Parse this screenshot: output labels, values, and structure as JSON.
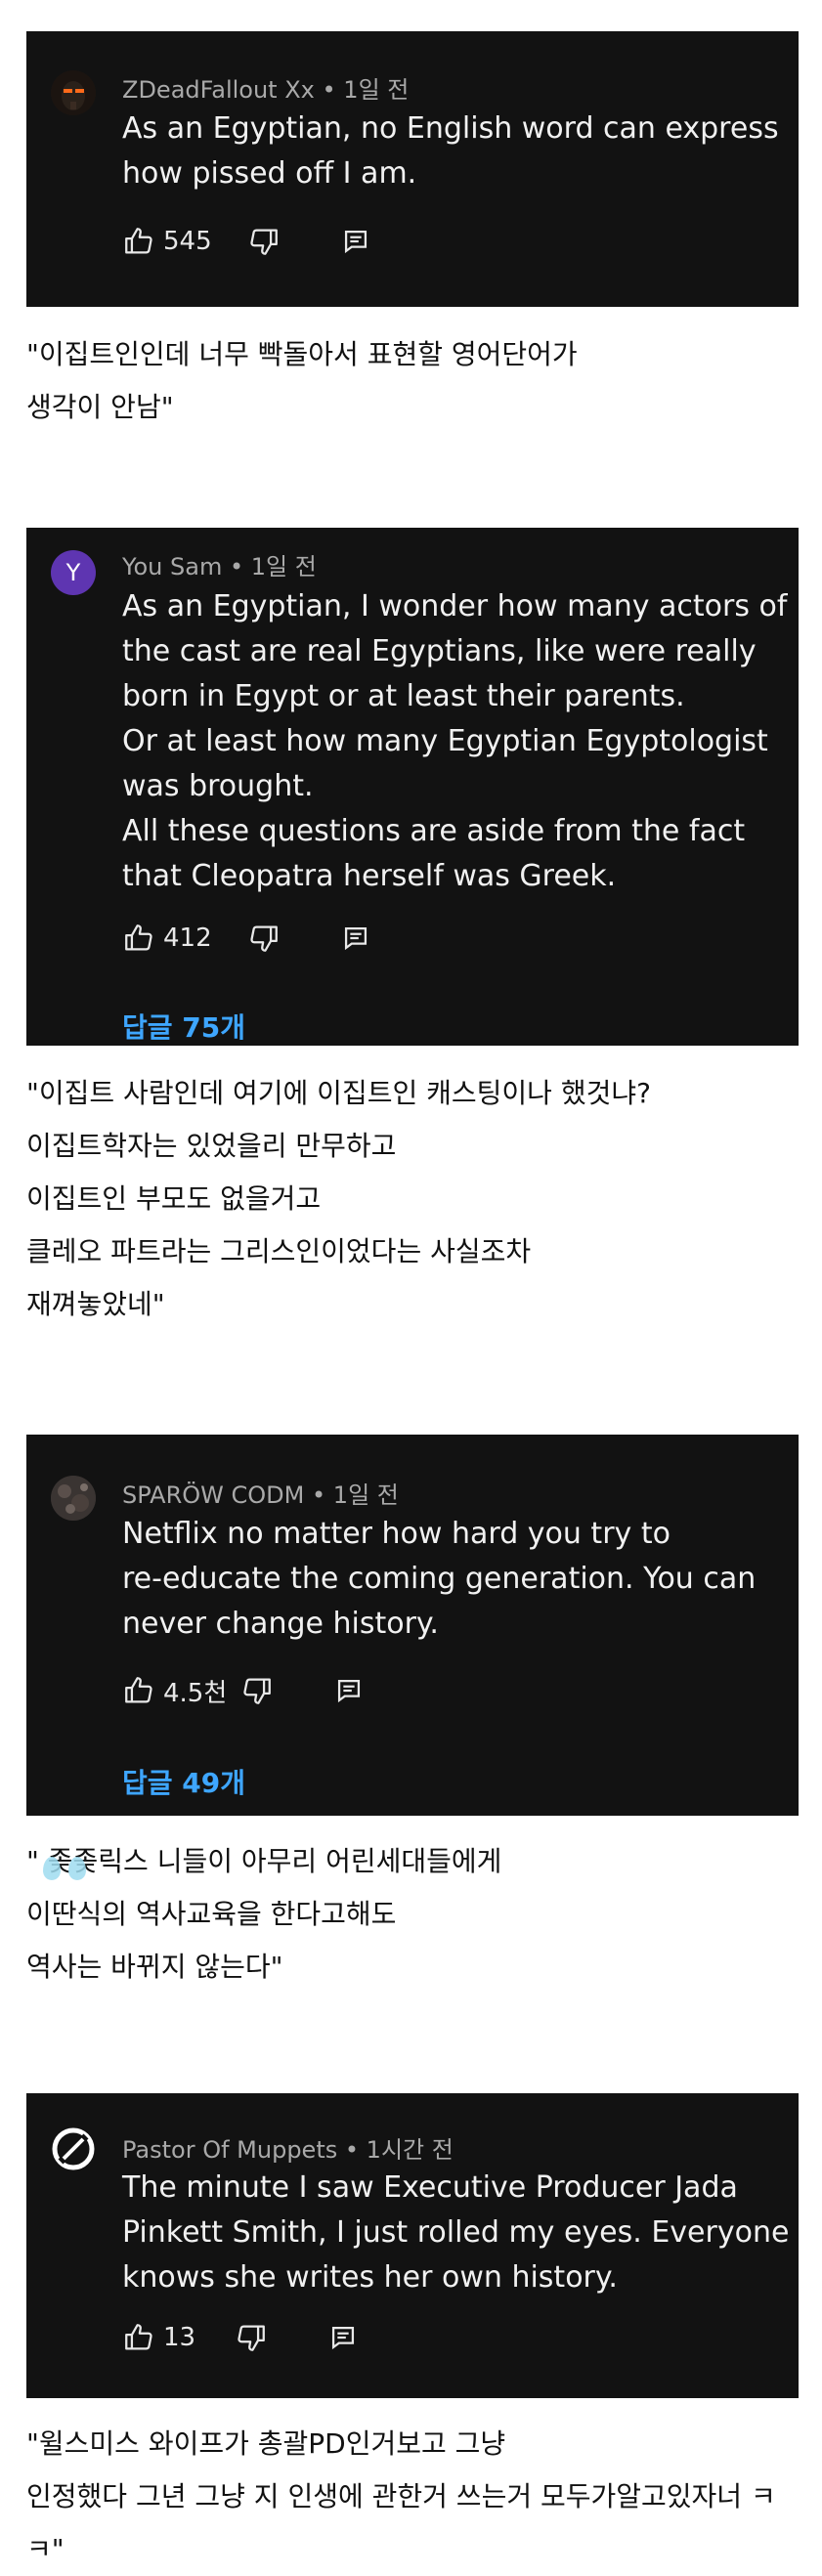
{
  "comments": [
    {
      "author": "ZDeadFallout Xx",
      "time": "1일 전",
      "lines": [
        "As an Egyptian, no English word can express",
        "how pissed off I am."
      ],
      "likes": "545",
      "avatar_letter": ""
    },
    {
      "author": "You Sam",
      "time": "1일 전",
      "lines": [
        "As an Egyptian, I wonder how many actors of",
        "the cast are real Egyptians, like were really",
        "born in Egypt or at least their parents.",
        "Or at least how many Egyptian Egyptologist",
        "was brought.",
        "All these questions are aside from the fact",
        "that Cleopatra herself was Greek."
      ],
      "likes": "412",
      "replies": "답글 75개",
      "avatar_letter": "Y",
      "avatar_color": "#5e35b1"
    },
    {
      "author": "SPARÖW CODM",
      "time": "1일 전",
      "lines": [
        "Netflix no matter how hard you try to",
        "re-educate the coming generation. You can",
        "never change history."
      ],
      "likes": "4.5천",
      "replies": "답글 49개",
      "avatar_letter": ""
    },
    {
      "author": "Pastor Of Muppets",
      "time": "1시간 전",
      "lines": [
        "The minute I saw Executive Producer Jada",
        "Pinkett Smith, I just rolled my eyes.  Everyone",
        "knows she writes her own history."
      ],
      "likes": "13",
      "avatar_letter": ""
    }
  ],
  "captions": [
    [
      "\"이집트인인데 너무 빡돌아서 표현할 영어단어가",
      "생각이 안남\""
    ],
    [
      "\"이집트 사람인데 여기에 이집트인 캐스팅이나 했것냐?",
      "이집트학자는 있었을리 만무하고",
      "이집트인 부모도 없을거고",
      "클레오 파트라는 그리스인이었다는 사실조차",
      "재껴놓았네\""
    ],
    [
      "\" 좆좆릭스 니들이 아무리 어린세대들에게",
      "이딴식의 역사교육을 한다고해도",
      "역사는 바뀌지 않는다\""
    ],
    [
      "\"윌스미스 와이프가 총괄PD인거보고 그냥",
      "인정했다 그년 그냥 지 인생에 관한거 쓰는거 모두가알고있자너 ㅋ",
      "ㅋ\""
    ]
  ],
  "colors": {
    "card_bg": "#121212",
    "meta": "#a9a9a9",
    "text": "#f1f1f1",
    "reply_link": "#3ea6ff"
  },
  "icons": [
    "like-icon",
    "dislike-icon",
    "reply-icon"
  ]
}
